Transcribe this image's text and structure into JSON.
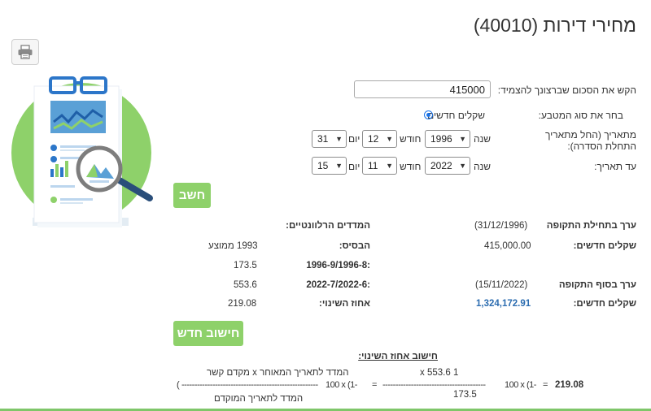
{
  "page": {
    "title": "מחירי דירות (40010)"
  },
  "toolbar": {
    "print_icon": "printer-icon"
  },
  "form": {
    "amount_label": "הקש את הסכום שברצונך להצמיד:",
    "amount_value": "415000",
    "currency_label": "בחר את סוג המטבע:",
    "currency_option": "שקלים חדשים",
    "from_label": "מתאריך (החל מתאריך התחלת הסדרה):",
    "to_label": "עד תאריך:",
    "year_label": "שנה",
    "month_label": "חודש",
    "day_label": "יום",
    "from": {
      "year": "1996",
      "month": "12",
      "day": "31"
    },
    "to": {
      "year": "2022",
      "month": "11",
      "day": "15"
    },
    "calc_button": "חשב"
  },
  "results": {
    "start_value_label": "ערך בתחילת התקופה",
    "start_date": "(31/12/1996)",
    "indices_label": "המדדים הרלוונטיים:",
    "start_currency_label": "שקלים חדשים:",
    "start_amount": "415,000.00",
    "base_label": "הבסיס:",
    "base_value": "1993 ממוצע",
    "start_period_label": "1996-9/1996-8:",
    "start_period_value": "173.5",
    "end_value_label": "ערך בסוף התקופה",
    "end_date": "(15/11/2022)",
    "end_period_label": "2022-7/2022-6:",
    "end_period_value": "553.6",
    "end_currency_label": "שקלים חדשים:",
    "end_amount": "1,324,172.91",
    "change_label": "אחוז השינוי:",
    "change_value": "219.08",
    "new_calc_button": "חישוב חדש"
  },
  "formula": {
    "heading": "חישוב אחוז השינוי:",
    "numerator_text": "המדד לתאריך המאוחר x מקדם קשר",
    "denominator_text": "המדד לתאריך המוקדם",
    "left_open": "(",
    "left_dashes": "-----------------------------------------------------",
    "left_tail": "100 x (1-",
    "eq1": "=",
    "num_value": "1 x 553.6",
    "den_value": "173.5",
    "right_dashes": "----------------------------------------",
    "right_tail": "100 x (1-",
    "eq2": "=",
    "result": "219.08",
    "close_paren": ")"
  }
}
